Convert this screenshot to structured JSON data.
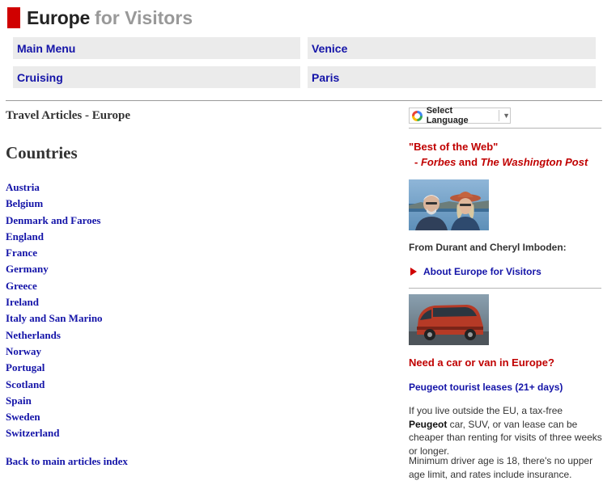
{
  "header": {
    "brand_name": "Europe",
    "brand_sub": "for Visitors"
  },
  "nav": {
    "main_menu": "Main Menu",
    "venice": "Venice",
    "cruising": "Cruising",
    "paris": "Paris"
  },
  "breadcrumb": "Travel Articles - Europe",
  "main": {
    "heading": "Countries",
    "countries": [
      "Austria",
      "Belgium",
      "Denmark and Faroes",
      "England",
      "France",
      "Germany",
      "Greece",
      "Ireland",
      "Italy and San Marino",
      "Netherlands",
      "Norway",
      "Portugal",
      "Scotland",
      "Spain",
      "Sweden",
      "Switzerland"
    ],
    "back_link": "Back to main articles index"
  },
  "sidebar": {
    "language_label": "Select Language",
    "language_arrow": "▼",
    "quote_line1": "\"Best of the Web\"",
    "quote_dash": "- ",
    "quote_forbes": "Forbes",
    "quote_and": " and ",
    "quote_wapo": "The Washington Post",
    "from_text": "From Durant and Cheryl Imboden:",
    "about_link": "About Europe for Visitors",
    "car_heading": "Need a car or van in Europe?",
    "peugeot_link": "Peugeot tourist leases (21+ days)",
    "para1_pre": "If you live outside the EU, a tax-free ",
    "para1_bold": "Peugeot",
    "para1_post": " car, SUV, or van lease can be cheaper than renting for visits of three weeks or longer.",
    "para2": "Minimum driver age is 18, there's no upper age limit, and rates include insurance."
  },
  "colors": {
    "brand_red": "#d00000",
    "link_blue": "#1414a8",
    "accent_red": "#c00000",
    "nav_bg": "#ebebeb"
  }
}
